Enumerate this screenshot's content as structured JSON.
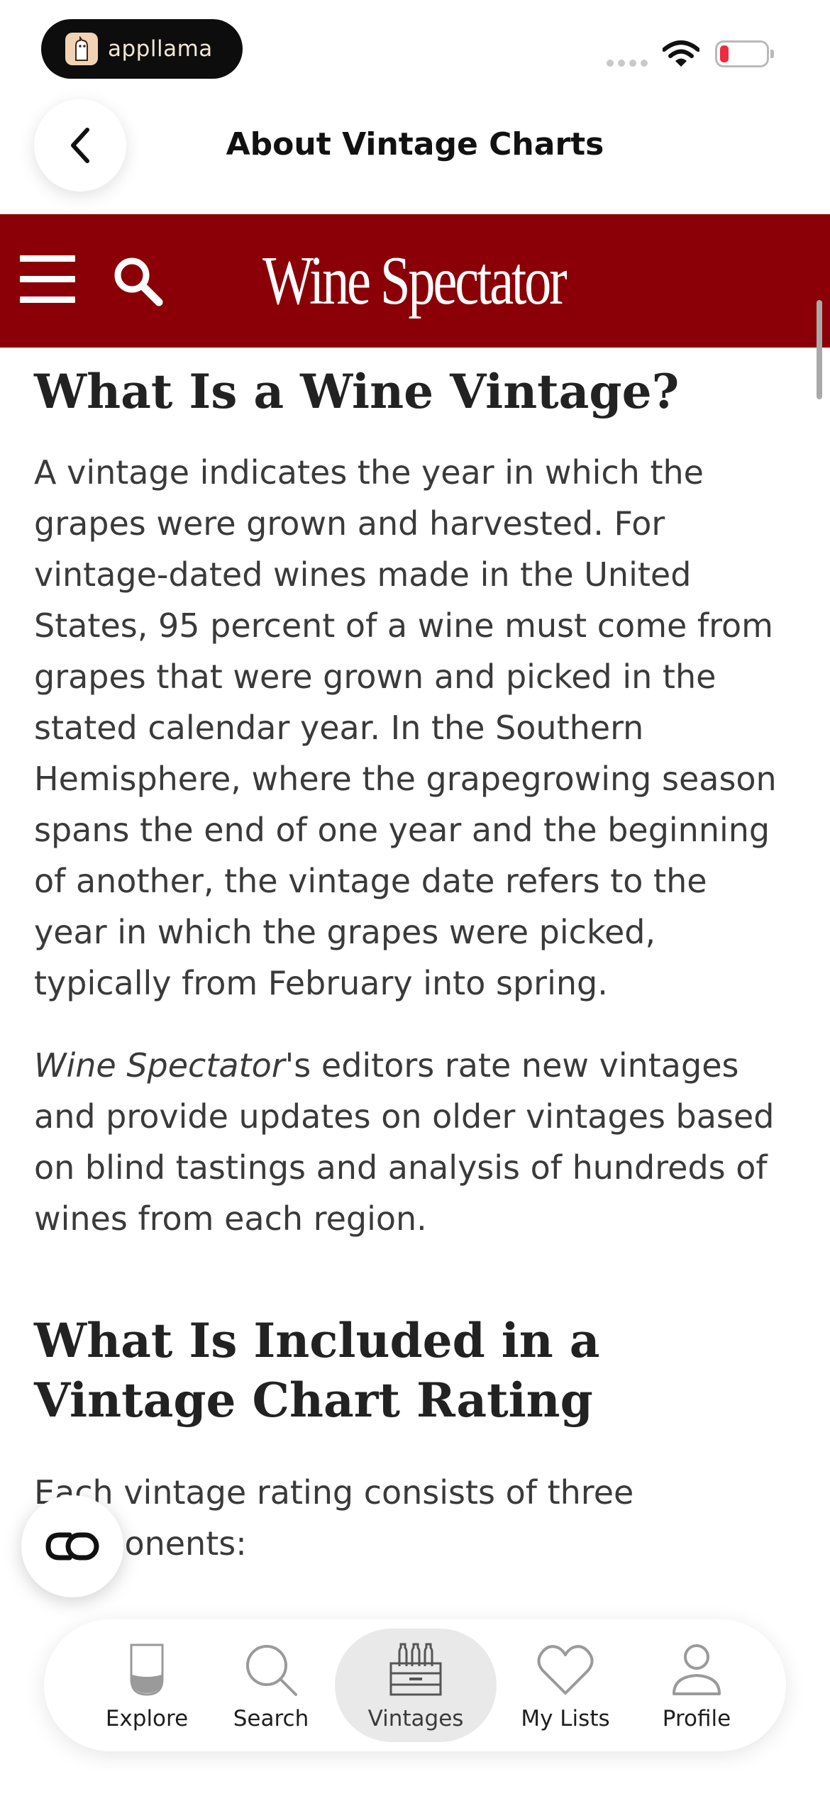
{
  "status_bar": {
    "brand": "appllama"
  },
  "header": {
    "title": "About Vintage Charts"
  },
  "site_bar": {
    "logo": "Wine Spectator"
  },
  "article": {
    "heading1": "What Is a Wine Vintage?",
    "para1": "A vintage indicates the year in which the grapes were grown and harvested. For vintage-dated wines made in the United States, 95 percent of a wine must come from grapes that were grown and picked in the stated calendar year. In the Southern Hemisphere, where the grapegrowing season spans the end of one year and the beginning of another, the vintage date refers to the year in which the grapes were picked, typically from February into spring.",
    "para2_italic": "Wine Spectator",
    "para2_rest": "'s editors rate new vintages and provide updates on older vintages based on blind tastings and analysis of hundreds of wines from each region.",
    "heading2": "What Is Included in a Vintage Chart Rating",
    "para3": "Each vintage rating consists of three components:"
  },
  "tabs": [
    {
      "label": "Explore",
      "icon": "wine-glass-icon"
    },
    {
      "label": "Search",
      "icon": "search-icon"
    },
    {
      "label": "Vintages",
      "icon": "wine-crate-icon"
    },
    {
      "label": "My Lists",
      "icon": "heart-icon"
    },
    {
      "label": "Profile",
      "icon": "profile-icon"
    }
  ],
  "colors": {
    "brand_red": "#8b0006",
    "battery_low": "#ef2b3f"
  }
}
